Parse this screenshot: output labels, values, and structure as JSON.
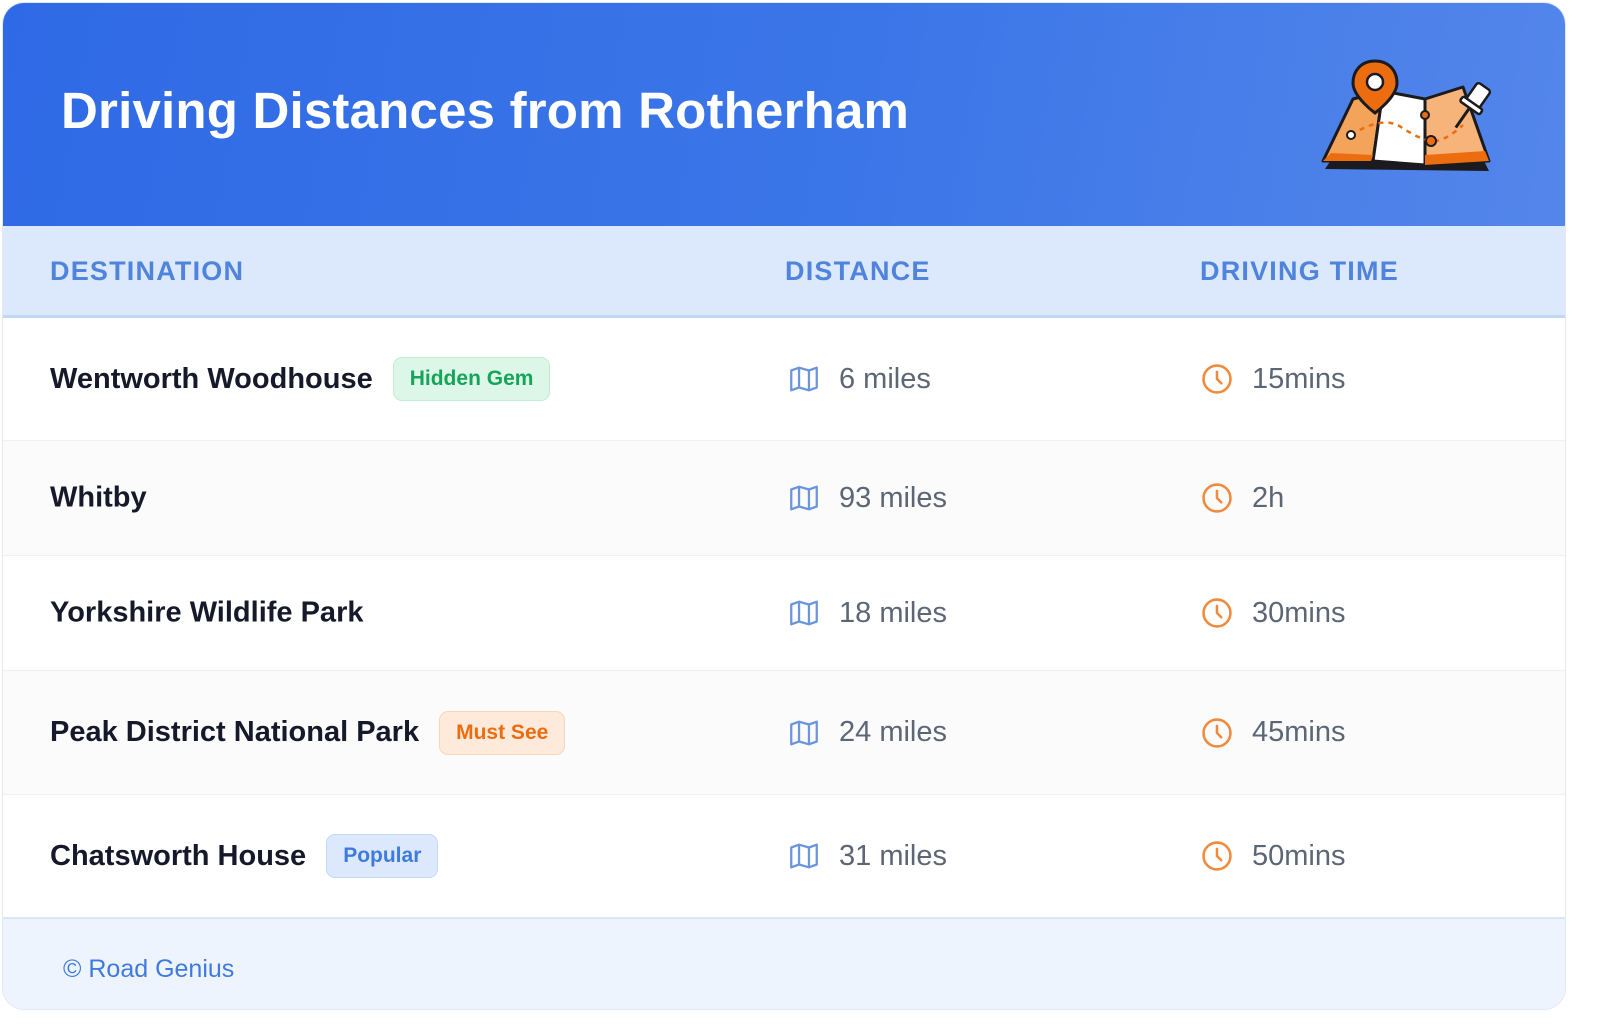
{
  "header": {
    "title": "Driving Distances from Rotherham",
    "illustration_icon": "map-pin-illustration"
  },
  "table": {
    "columns": [
      "DESTINATION",
      "DISTANCE",
      "DRIVING TIME"
    ],
    "rows": [
      {
        "destination": "Wentworth Woodhouse",
        "badge": "Hidden Gem",
        "badge_style": "green",
        "distance": "6 miles",
        "time": "15mins"
      },
      {
        "destination": "Whitby",
        "badge": "",
        "badge_style": "",
        "distance": "93 miles",
        "time": "2h"
      },
      {
        "destination": "Yorkshire Wildlife Park",
        "badge": "",
        "badge_style": "",
        "distance": "18 miles",
        "time": "30mins"
      },
      {
        "destination": "Peak District National Park",
        "badge": "Must See",
        "badge_style": "orange",
        "distance": "24 miles",
        "time": "45mins"
      },
      {
        "destination": "Chatsworth House",
        "badge": "Popular",
        "badge_style": "blue",
        "distance": "31 miles",
        "time": "50mins"
      }
    ],
    "distance_icon": "map-icon",
    "time_icon": "clock-icon"
  },
  "footer": {
    "copyright": "© Road Genius"
  },
  "colors": {
    "header_blue": "#2f6ae6",
    "accent_orange": "#f08a3c",
    "badge_green": "#16a35a",
    "badge_orange": "#ec6d10",
    "badge_blue": "#3f7bde"
  }
}
